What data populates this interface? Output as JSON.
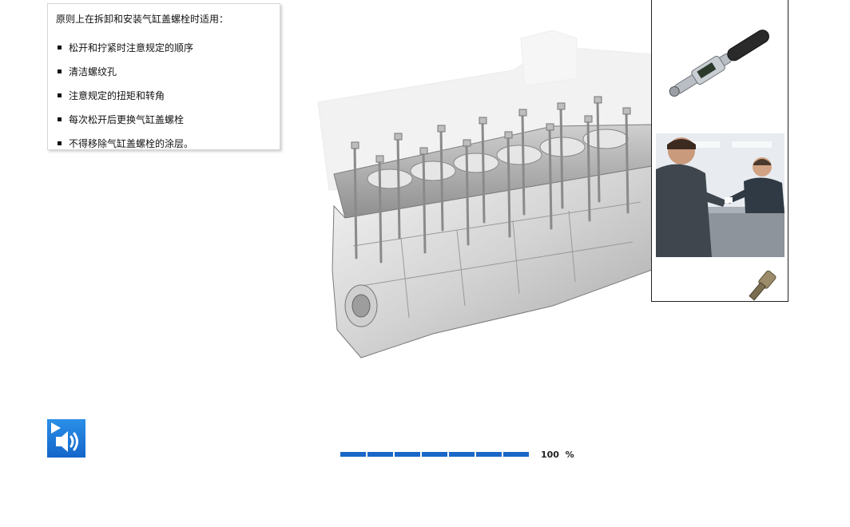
{
  "instructions": {
    "title": "原则上在拆卸和安装气缸盖螺栓时适用：",
    "items": [
      "松开和拧紧时注意规定的顺序",
      "清洁螺纹孔",
      "注意规定的扭矩和转角",
      "每次松开后更换气缸盖螺栓",
      "不得移除气缸盖螺栓的涂层。"
    ]
  },
  "progress": {
    "percent": 100,
    "value_label": "100",
    "unit_label": "%",
    "segments": 7
  },
  "icons": {
    "audio": "play-speaker-icon",
    "wrench": "torque-wrench-icon"
  },
  "colors": {
    "accent": "#1a67c7",
    "audio_button": "#1f7ad8"
  }
}
